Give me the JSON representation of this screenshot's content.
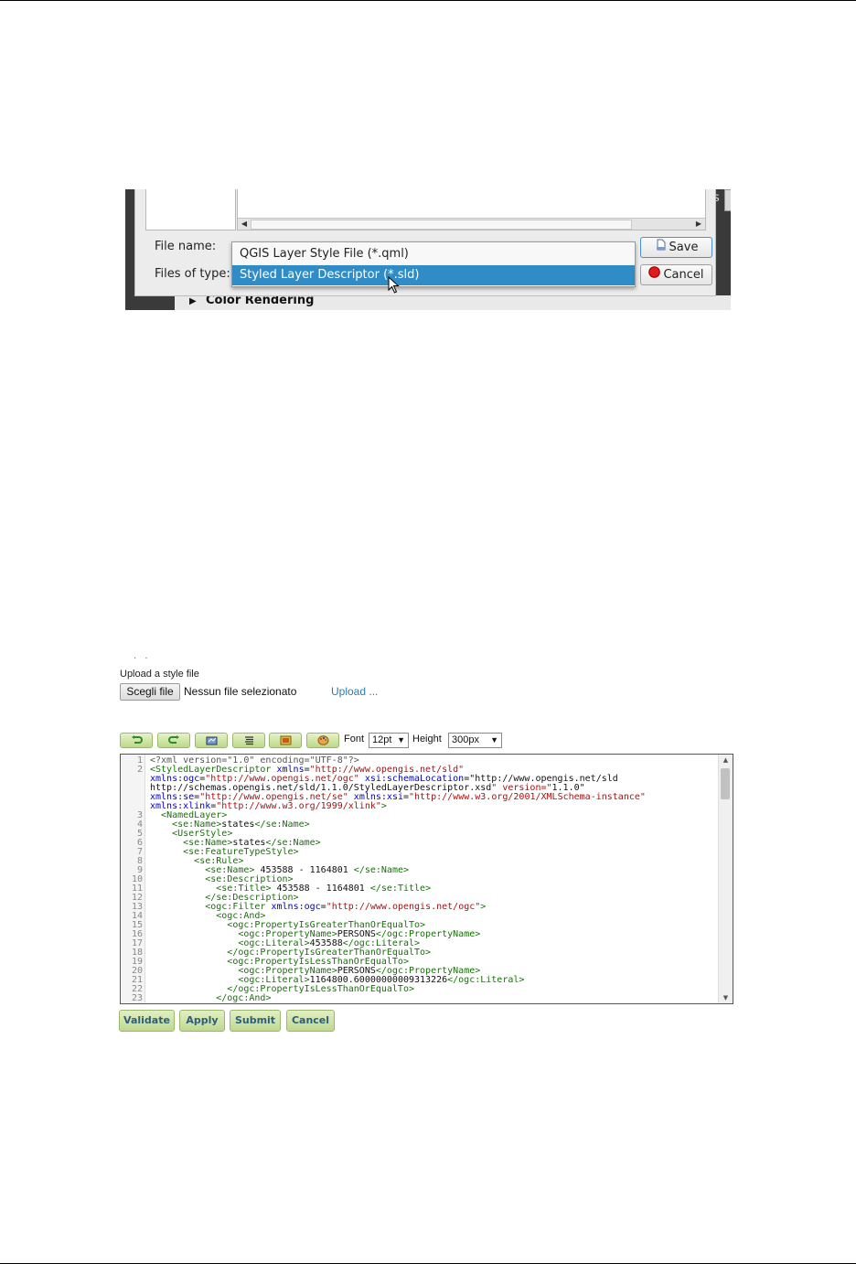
{
  "dialog": {
    "file_name_label": "File name:",
    "files_of_type_label": "Files of type:",
    "side_letter": "s",
    "type_options": [
      {
        "label": "QGIS Layer Style File (*.qml)",
        "selected": false
      },
      {
        "label": "Styled Layer Descriptor (*.sld)",
        "selected": true
      }
    ],
    "save_label": "Save",
    "cancel_label": "Cancel",
    "background_section": "Color Rendering",
    "icons": {
      "save": "save-icon",
      "cancel": "cancel-icon",
      "cursor": "mouse-cursor-icon"
    }
  },
  "editor_page": {
    "nav_dots": ". .",
    "upload_label": "Upload a style file",
    "choose_file_label": "Scegli file",
    "no_file_text": "Nessun file selezionato",
    "upload_link": "Upload ...",
    "toolbar": {
      "buttons": [
        "undo-icon",
        "redo-icon",
        "goto-line-icon",
        "reformat-icon",
        "image-icon",
        "palette-icon"
      ],
      "font_label": "Font",
      "font_value": "12pt",
      "height_label": "Height",
      "height_value": "300px"
    },
    "line_numbers": "1\n2\n\n\n\n\n3\n4\n5\n6\n7\n8\n9\n10\n11\n12\n13\n14\n15\n16\n17\n18\n19\n20\n21\n22\n23",
    "code_lines": [
      "<?xml version=\"1.0\" encoding=\"UTF-8\"?>",
      "<StyledLayerDescriptor xmlns=\"http://www.opengis.net/sld\"",
      "xmlns:ogc=\"http://www.opengis.net/ogc\" xsi:schemaLocation=\"http://www.opengis.net/sld",
      "http://schemas.opengis.net/sld/1.1.0/StyledLayerDescriptor.xsd\" version=\"1.1.0\"",
      "xmlns:se=\"http://www.opengis.net/se\" xmlns:xsi=\"http://www.w3.org/2001/XMLSchema-instance\"",
      "xmlns:xlink=\"http://www.w3.org/1999/xlink\">",
      "  <NamedLayer>",
      "    <se:Name>states</se:Name>",
      "    <UserStyle>",
      "      <se:Name>states</se:Name>",
      "      <se:FeatureTypeStyle>",
      "        <se:Rule>",
      "          <se:Name> 453588 - 1164801 </se:Name>",
      "          <se:Description>",
      "            <se:Title> 453588 - 1164801 </se:Title>",
      "          </se:Description>",
      "          <ogc:Filter xmlns:ogc=\"http://www.opengis.net/ogc\">",
      "            <ogc:And>",
      "              <ogc:PropertyIsGreaterThanOrEqualTo>",
      "                <ogc:PropertyName>PERSONS</ogc:PropertyName>",
      "                <ogc:Literal>453588</ogc:Literal>",
      "              </ogc:PropertyIsGreaterThanOrEqualTo>",
      "              <ogc:PropertyIsLessThanOrEqualTo>",
      "                <ogc:PropertyName>PERSONS</ogc:PropertyName>",
      "                <ogc:Literal>1164800.60000000009313226</ogc:Literal>",
      "              </ogc:PropertyIsLessThanOrEqualTo>",
      "            </ogc:And>"
    ],
    "actions": [
      "Validate",
      "Apply",
      "Submit",
      "Cancel"
    ]
  }
}
